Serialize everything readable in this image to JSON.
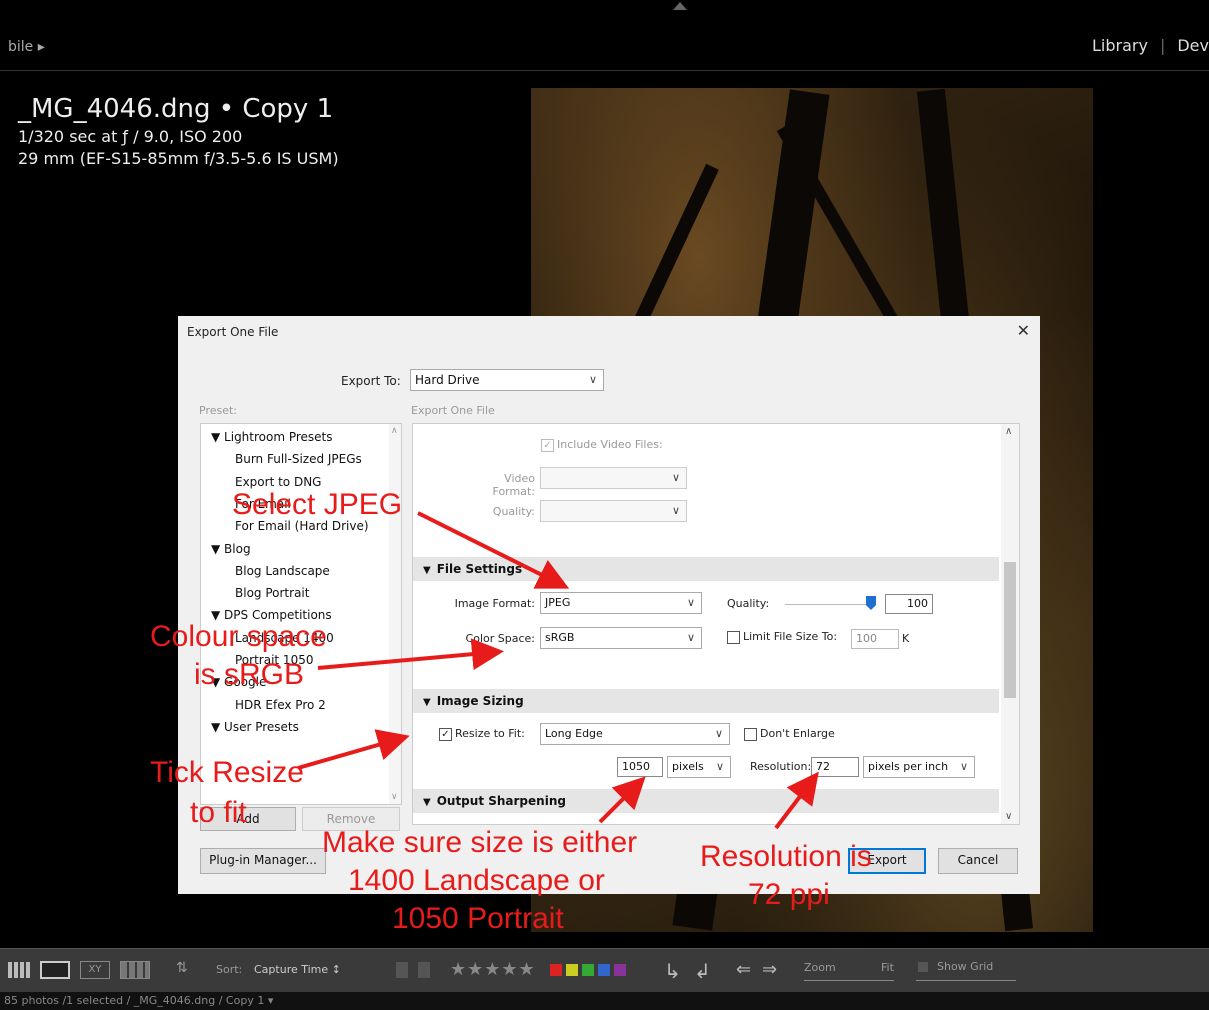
{
  "topbar": {
    "left_text": "bile ▸",
    "module_active": "Library",
    "module_next": "Dev"
  },
  "info": {
    "filename": "_MG_4046.dng • Copy 1",
    "exposure": "1/320 sec at ƒ / 9.0, ISO 200",
    "lens": "29 mm (EF-S15-85mm f/3.5-5.6 IS USM)"
  },
  "dialog": {
    "title": "Export One File",
    "close_glyph": "✕",
    "export_to_label": "Export To:",
    "export_to_value": "Hard Drive",
    "preset_label": "Preset:",
    "panel_label": "Export One File",
    "presets": [
      {
        "label": "▼  Lightroom Presets",
        "indent": 0
      },
      {
        "label": "Burn Full-Sized JPEGs",
        "indent": 1
      },
      {
        "label": "Export to DNG",
        "indent": 1
      },
      {
        "label": "For Email",
        "indent": 1
      },
      {
        "label": "For Email (Hard Drive)",
        "indent": 1
      },
      {
        "label": "▼  Blog",
        "indent": 0
      },
      {
        "label": "Blog Landscape",
        "indent": 1
      },
      {
        "label": "Blog Portrait",
        "indent": 1
      },
      {
        "label": "▼  DPS Competitions",
        "indent": 0
      },
      {
        "label": "Landscape 1400",
        "indent": 1
      },
      {
        "label": "Portrait 1050",
        "indent": 1
      },
      {
        "label": "▼  Google",
        "indent": 0
      },
      {
        "label": "HDR Efex Pro 2",
        "indent": 1
      },
      {
        "label": "▼  User Presets",
        "indent": 0
      }
    ],
    "add_button": "Add",
    "remove_button": "Remove",
    "plugin_button": "Plug-in Manager...",
    "export_button": "Export",
    "cancel_button": "Cancel",
    "video": {
      "include_label": "Include Video Files:",
      "format_label": "Video Format:",
      "quality_label": "Quality:"
    },
    "file_settings": {
      "header": "File Settings",
      "image_format_label": "Image Format:",
      "image_format_value": "JPEG",
      "quality_label": "Quality:",
      "quality_value": "100",
      "quality_fraction": 1.0,
      "color_space_label": "Color Space:",
      "color_space_value": "sRGB",
      "limit_label": "Limit File Size To:",
      "limit_value": "100",
      "limit_unit": "K"
    },
    "image_sizing": {
      "header": "Image Sizing",
      "resize_label": "Resize to Fit:",
      "resize_value": "Long Edge",
      "dont_enlarge_label": "Don't Enlarge",
      "size_value": "1050",
      "size_unit": "pixels",
      "resolution_label": "Resolution:",
      "resolution_value": "72",
      "resolution_unit": "pixels per inch"
    },
    "output_sharpening": {
      "header": "Output Sharpening"
    }
  },
  "annotations": {
    "select_jpeg": "Select JPEG",
    "colour_space_1": "Colour space",
    "colour_space_2": "is sRGB",
    "tick_resize_1": "Tick Resize",
    "tick_resize_2": "to fit",
    "size_1": "Make sure size is either",
    "size_2": "1400 Landscape or",
    "size_3": "1050 Portrait",
    "res_1": "Resolution is",
    "res_2": "72 ppi",
    "color": "#e81b1b"
  },
  "bottombar": {
    "sort_label": "Sort:",
    "sort_value": "Capture Time ↕",
    "stars": "★★★★★",
    "zoom_label": "Zoom",
    "fit_label": "Fit",
    "show_grid_label": "Show Grid",
    "color_labels": [
      "#d22",
      "#cc2",
      "#3a3",
      "#36c",
      "#839"
    ]
  },
  "statusbar": {
    "text": "85 photos /1 selected /  _MG_4046.dng / Copy 1 ▾"
  }
}
